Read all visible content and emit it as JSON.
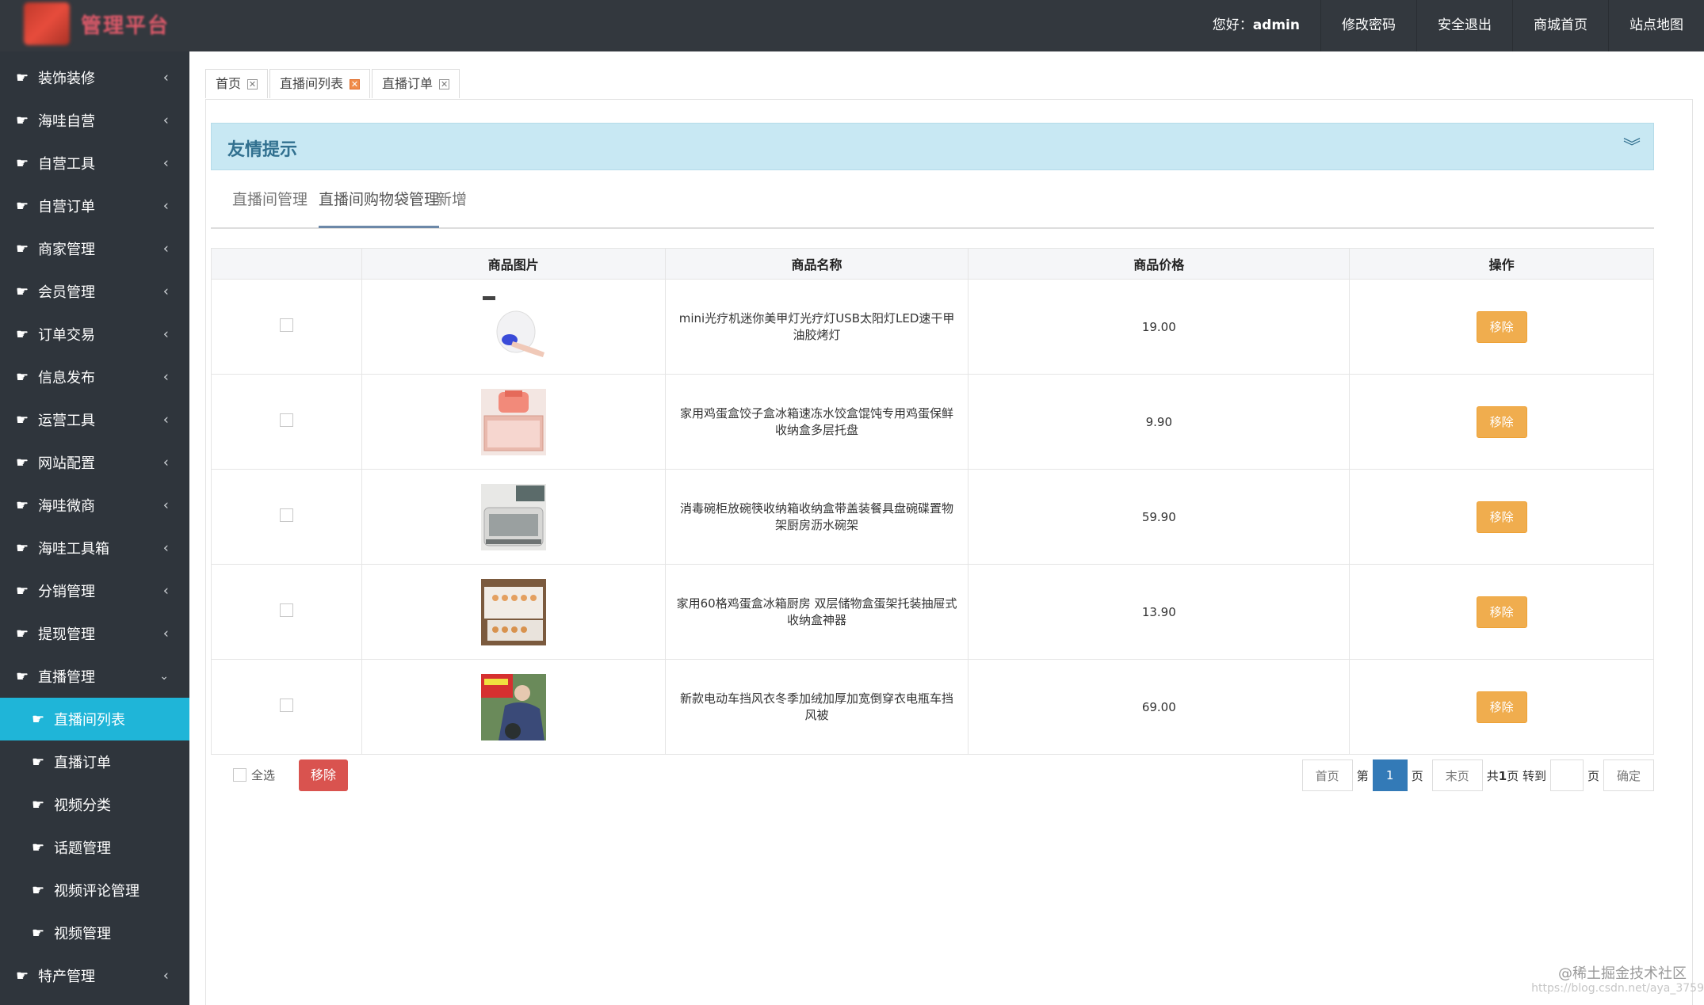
{
  "header": {
    "logo_text": "管理平台",
    "greeting_prefix": "您好：",
    "username": "admin",
    "links": [
      "修改密码",
      "安全退出",
      "商城首页",
      "站点地图"
    ]
  },
  "sidebar": {
    "items": [
      {
        "label": "装饰装修",
        "expanded": false
      },
      {
        "label": "海哇自营",
        "expanded": false
      },
      {
        "label": "自营工具",
        "expanded": false
      },
      {
        "label": "自营订单",
        "expanded": false
      },
      {
        "label": "商家管理",
        "expanded": false
      },
      {
        "label": "会员管理",
        "expanded": false
      },
      {
        "label": "订单交易",
        "expanded": false
      },
      {
        "label": "信息发布",
        "expanded": false
      },
      {
        "label": "运营工具",
        "expanded": false
      },
      {
        "label": "网站配置",
        "expanded": false
      },
      {
        "label": "海哇微商",
        "expanded": false
      },
      {
        "label": "海哇工具箱",
        "expanded": false
      },
      {
        "label": "分销管理",
        "expanded": false
      },
      {
        "label": "提现管理",
        "expanded": false
      },
      {
        "label": "直播管理",
        "expanded": true
      }
    ],
    "sub_items": [
      "直播间列表",
      "直播订单",
      "视频分类",
      "话题管理",
      "视频评论管理",
      "视频管理"
    ],
    "last_item": "特产管理"
  },
  "page_tabs": [
    "首页",
    "直播间列表",
    "直播订单"
  ],
  "notice": {
    "title": "友情提示"
  },
  "subtabs": [
    "直播间管理",
    "直播间购物袋管理",
    "新增"
  ],
  "table": {
    "headers": [
      "",
      "商品图片",
      "商品名称",
      "商品价格",
      "操作"
    ],
    "rows": [
      {
        "name": "mini光疗机迷你美甲灯光疗灯USB太阳灯LED速干甲油胶烤灯",
        "price": "19.00",
        "action": "移除"
      },
      {
        "name": "家用鸡蛋盒饺子盒冰箱速冻水饺盒馄饨专用鸡蛋保鲜收纳盒多层托盘",
        "price": "9.90",
        "action": "移除"
      },
      {
        "name": "消毒碗柜放碗筷收纳箱收纳盒带盖装餐具盘碗碟置物架厨房沥水碗架",
        "price": "59.90",
        "action": "移除"
      },
      {
        "name": "家用60格鸡蛋盒冰箱厨房 双层储物盒蛋架托装抽屉式收纳盒神器",
        "price": "13.90",
        "action": "移除"
      },
      {
        "name": "新款电动车挡风衣冬季加绒加厚加宽倒穿衣电瓶车挡风被",
        "price": "69.00",
        "action": "移除"
      }
    ]
  },
  "footer": {
    "select_all": "全选",
    "remove_button": "移除",
    "pager": {
      "first": "首页",
      "di": "第",
      "current": "1",
      "ye": "页",
      "last": "末页",
      "gong": "共",
      "total": "1",
      "ye_zhuandao": "页 转到",
      "ye2": "页",
      "confirm": "确定"
    }
  },
  "watermark": "@稀土掘金技术社区",
  "watermark_url": "https://blog.csdn.net/aya_3759"
}
